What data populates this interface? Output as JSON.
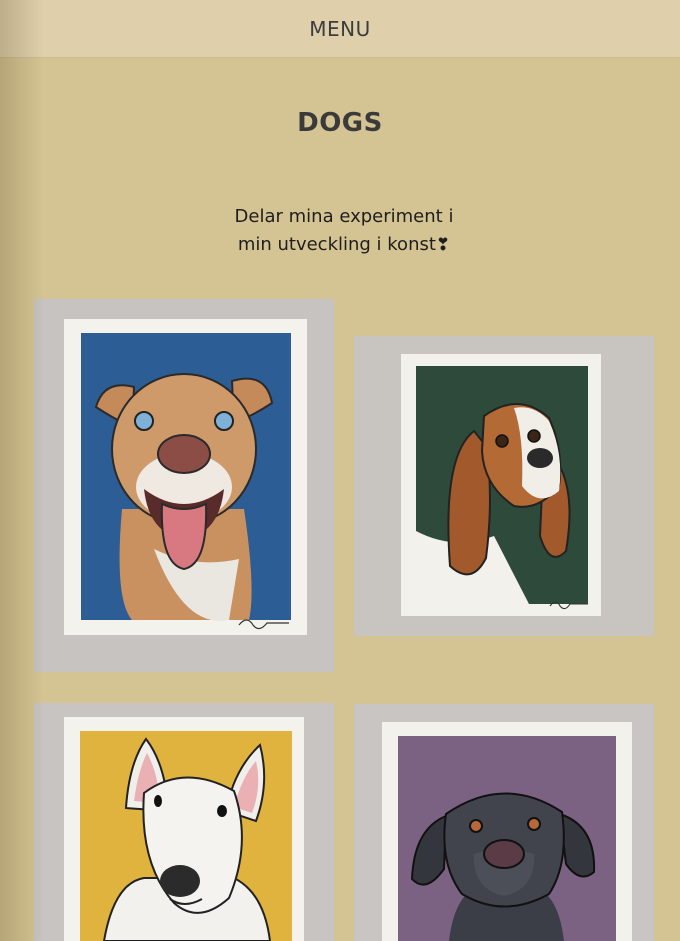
{
  "header": {
    "menu_label": "MENU"
  },
  "page": {
    "title": "DOGS",
    "intro_line1": "Delar mina experiment i",
    "intro_line2": "min utveckling i konst",
    "intro_heart": "❣"
  },
  "gallery": {
    "items": [
      {
        "subject": "pitbull",
        "background_color": "#2c5d94"
      },
      {
        "subject": "basset-hound",
        "background_color": "#2e4a3b"
      },
      {
        "subject": "bull-terrier",
        "background_color": "#e0b23e"
      },
      {
        "subject": "black-labrador",
        "background_color": "#7b6282"
      }
    ]
  },
  "colors": {
    "page_background": "#d5c493",
    "menu_bar": "#dfd0ab",
    "text": "#333333"
  }
}
